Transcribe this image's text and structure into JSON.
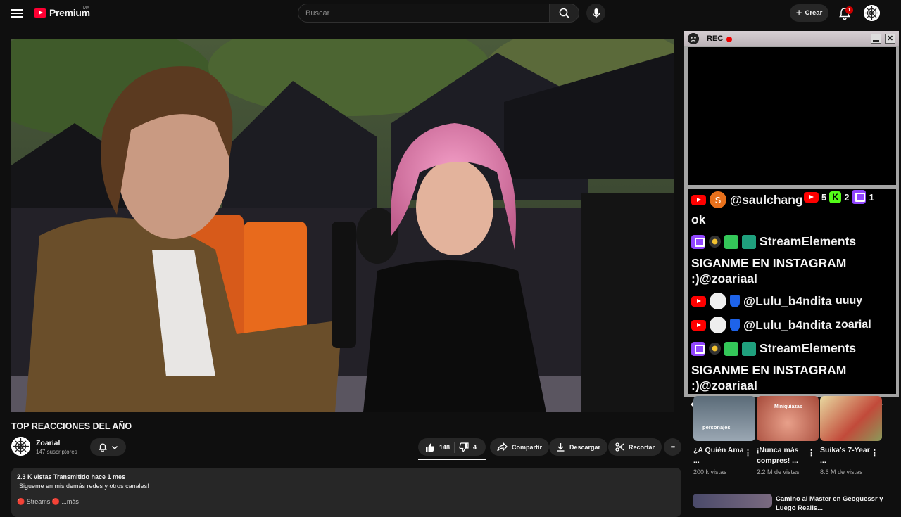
{
  "header": {
    "logo_text": "Premium",
    "region": "MX",
    "search_placeholder": "Buscar",
    "create_label": "Crear",
    "notification_count": "1"
  },
  "video": {
    "title": "TOP REACCIONES DEL AÑO",
    "channel_name": "Zoarial",
    "subscribers": "147 suscriptores",
    "likes": "148",
    "dislikes": "4",
    "share_label": "Compartir",
    "download_label": "Descargar",
    "clip_label": "Recortar",
    "more_label": "•••"
  },
  "description": {
    "stats": "2.3 K vistas  Transmitido hace 1 mes",
    "line": "¡Sigueme en mis demás redes y otros canales!",
    "tail": "🔴 Streams 🔴 ...más"
  },
  "overlay": {
    "rec_label": "REC",
    "close_label": "✕",
    "counts": {
      "youtube": "5",
      "kick": "2",
      "twitch": "1"
    },
    "chat": [
      {
        "platform": "youtube",
        "avatar_letter": "S",
        "username": "@saulchang",
        "message": "ok"
      },
      {
        "platform": "twitch",
        "username": "StreamElements",
        "message_line1": "SIGANME EN INSTAGRAM",
        "message_line2": ":)@zoariaal"
      },
      {
        "platform": "youtube",
        "username": "@Lulu_b4ndita",
        "message": "uuuy"
      },
      {
        "platform": "youtube",
        "username": "@Lulu_b4ndita",
        "message": "zoarial"
      },
      {
        "platform": "twitch",
        "username": "StreamElements",
        "message_line1": "SIGANME EN INSTAGRAM",
        "message_line2": ":)@zoariaal"
      }
    ]
  },
  "recommendations": {
    "shorts": [
      {
        "thumb_label": "personajes",
        "title": "¿A Quién Ama ...",
        "views": "200 k vistas"
      },
      {
        "thumb_label": "Miniquiazas",
        "title": "¡Nunca más compres! ...",
        "views": "2.2 M de vistas"
      },
      {
        "thumb_label": "",
        "title": "Suika's 7-Year ...",
        "views": "8.6 M de vistas"
      }
    ],
    "video_title": "Camino al Master en Geoguessr y Luego Realis..."
  },
  "colors": {
    "youtube_red": "#ff0000",
    "twitch_purple": "#9146ff",
    "kick_green": "#53fc18",
    "background": "#0f0f0f"
  }
}
